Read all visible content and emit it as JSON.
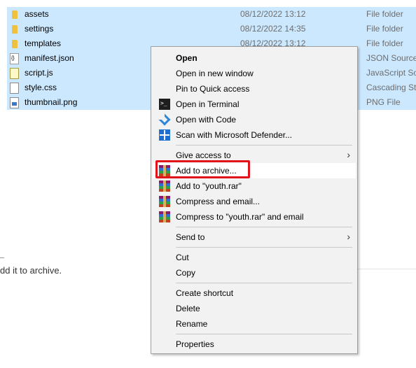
{
  "files": [
    {
      "name": "assets",
      "date": "08/12/2022 13:12",
      "type": "File folder",
      "icon": "folder-icon"
    },
    {
      "name": "settings",
      "date": "08/12/2022 14:35",
      "type": "File folder",
      "icon": "folder-icon"
    },
    {
      "name": "templates",
      "date": "08/12/2022 13:12",
      "type": "File folder",
      "icon": "folder-icon"
    },
    {
      "name": "manifest.json",
      "date": "",
      "type": "JSON Source",
      "icon": "json-file-icon"
    },
    {
      "name": "script.js",
      "date": "",
      "type": "JavaScript Sou",
      "icon": "js-file-icon"
    },
    {
      "name": "style.css",
      "date": "",
      "type": "Cascading Sty",
      "icon": "css-file-icon"
    },
    {
      "name": "thumbnail.png",
      "date": "",
      "type": "PNG File",
      "icon": "png-file-icon"
    }
  ],
  "background_text": "dd it to archive.",
  "context_menu": {
    "items": [
      {
        "label": "Open"
      },
      {
        "label": "Open in new window"
      },
      {
        "label": "Pin to Quick access"
      },
      {
        "label": "Open in Terminal"
      },
      {
        "label": "Open with Code"
      },
      {
        "label": "Scan with Microsoft Defender..."
      },
      {
        "label": "Give access to"
      },
      {
        "label": "Add to archive..."
      },
      {
        "label": "Add to \"youth.rar\""
      },
      {
        "label": "Compress and email..."
      },
      {
        "label": "Compress to \"youth.rar\" and email"
      },
      {
        "label": "Send to"
      },
      {
        "label": "Cut"
      },
      {
        "label": "Copy"
      },
      {
        "label": "Create shortcut"
      },
      {
        "label": "Delete"
      },
      {
        "label": "Rename"
      },
      {
        "label": "Properties"
      }
    ],
    "submenu_arrow": "›",
    "highlight_color": "#e3131b"
  },
  "colors": {
    "selection": "#cce8ff",
    "menu_bg": "#f2f2f2"
  }
}
